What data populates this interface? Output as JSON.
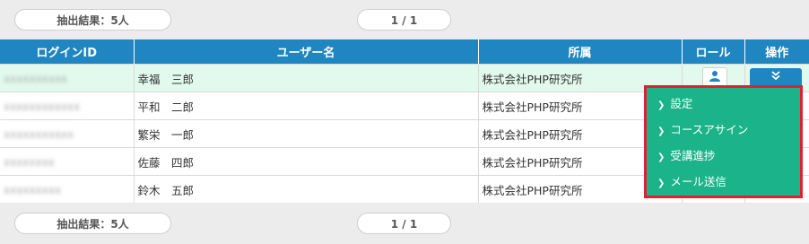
{
  "summary": {
    "count": "抽出結果：5人",
    "page": "1 / 1"
  },
  "table": {
    "headers": [
      "ログインID",
      "ユーザー名",
      "所属",
      "ロール",
      "操作"
    ],
    "rows": [
      {
        "login": "",
        "name": "幸福　三郎",
        "org": "株式会社PHP研究所"
      },
      {
        "login": "",
        "name": "平和　二郎",
        "org": "株式会社PHP研究所"
      },
      {
        "login": "",
        "name": "繁栄　一郎",
        "org": "株式会社PHP研究所"
      },
      {
        "login": "",
        "name": "佐藤　四郎",
        "org": "株式会社PHP研究所"
      },
      {
        "login": "",
        "name": "鈴木　五郎",
        "org": "株式会社PHP研究所"
      }
    ]
  },
  "icons": {
    "role": "user-icon",
    "operate": "chevron-double-down-icon"
  },
  "menu": {
    "items": [
      "設定",
      "コースアサイン",
      "受講進捗",
      "メール送信"
    ]
  },
  "colors": {
    "header": "#1f86c1",
    "selected_row": "#e2faee",
    "menu_bg": "#1ab38a",
    "menu_border": "#e0202e"
  }
}
